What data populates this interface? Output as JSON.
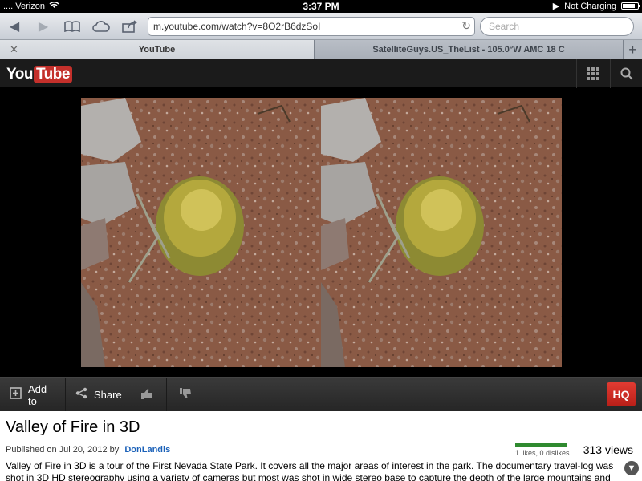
{
  "status_bar": {
    "carrier": ".... Verizon",
    "time": "3:37 PM",
    "charging": "Not Charging",
    "battery_level": 0.85
  },
  "browser": {
    "url": "m.youtube.com/watch?v=8O2rB6dzSoI",
    "search_placeholder": "Search",
    "tabs": [
      {
        "label": "YouTube"
      },
      {
        "label": "SatelliteGuys.US_TheList - 105.0°W AMC 18 C"
      }
    ]
  },
  "youtube": {
    "logo_you": "You",
    "logo_tube": "Tube",
    "actions": {
      "add_to": "Add to",
      "share": "Share",
      "hq": "HQ"
    },
    "video": {
      "title": "Valley of Fire in 3D",
      "published_label": "Published on",
      "published_date": "Jul 20, 2012",
      "by_label": "by",
      "author": "DonLandis",
      "likes_text": "1 likes, 0 dislikes",
      "views": "313 views",
      "description": "Valley of Fire in 3D is a tour of the First Nevada State Park. It covers all the major areas of interest in the park. The documentary travel-log was shot in 3D HD stereography using a variety of cameras but most was shot in wide stereo base to capture the depth of the large mountains and rock"
    }
  },
  "colors": {
    "brand_red": "#c4302b",
    "like_green": "#2f8a2f",
    "link_blue": "#1c62b9"
  }
}
